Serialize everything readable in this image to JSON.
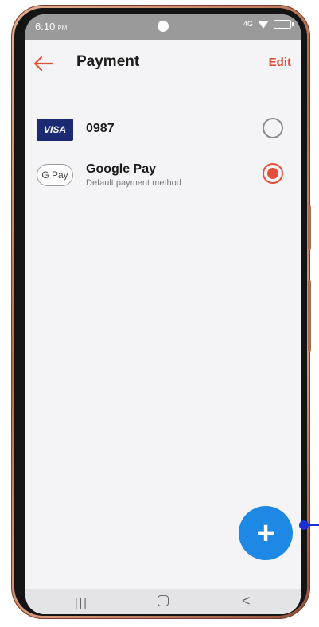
{
  "status_bar": {
    "time": "6:10",
    "ampm": "PM",
    "network": "4G"
  },
  "appbar": {
    "title": "Payment",
    "edit_label": "Edit"
  },
  "payment_methods": [
    {
      "brand_label": "VISA",
      "name": "0987",
      "selected": false
    },
    {
      "brand_label": "G Pay",
      "name": "Google Pay",
      "subtitle": "Default payment method",
      "selected": true
    }
  ],
  "fab": {
    "icon": "+"
  },
  "nav": {
    "recent_icon": "|||",
    "back_icon": "<"
  },
  "colors": {
    "accent": "#e2503b",
    "fab": "#1e88e5",
    "visa": "#1b2a72"
  }
}
